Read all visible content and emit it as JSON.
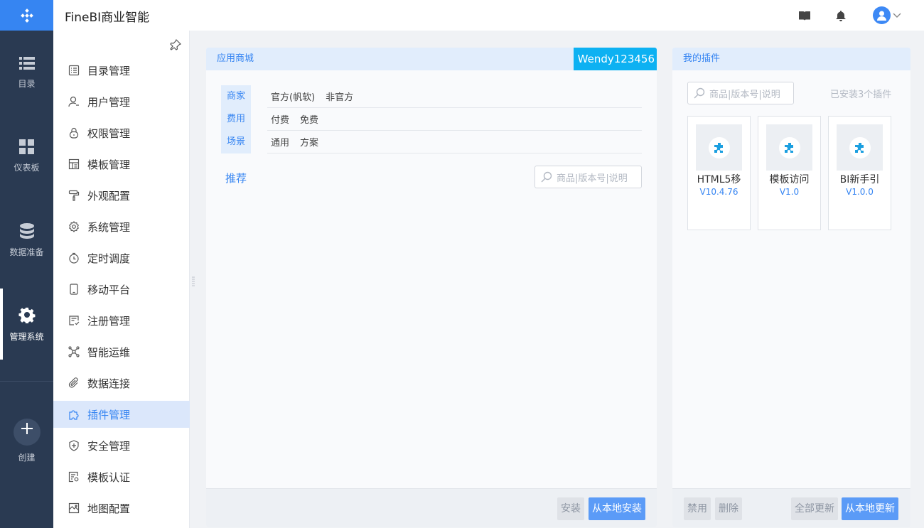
{
  "app": {
    "title": "FineBI商业智能"
  },
  "rail": {
    "items": [
      {
        "label": "目录",
        "icon": "list-icon"
      },
      {
        "label": "仪表板",
        "icon": "dashboard-icon"
      },
      {
        "label": "数据准备",
        "icon": "database-icon"
      },
      {
        "label": "管理系统",
        "icon": "gear-icon",
        "active": true
      },
      {
        "label": "创建",
        "icon": "plus-icon"
      }
    ]
  },
  "subnav": {
    "items": [
      {
        "label": "目录管理"
      },
      {
        "label": "用户管理"
      },
      {
        "label": "权限管理"
      },
      {
        "label": "模板管理"
      },
      {
        "label": "外观配置"
      },
      {
        "label": "系统管理"
      },
      {
        "label": "定时调度"
      },
      {
        "label": "移动平台"
      },
      {
        "label": "注册管理"
      },
      {
        "label": "智能运维"
      },
      {
        "label": "数据连接"
      },
      {
        "label": "插件管理",
        "active": true
      },
      {
        "label": "安全管理"
      },
      {
        "label": "模板认证"
      },
      {
        "label": "地图配置"
      }
    ]
  },
  "store": {
    "title": "应用商城",
    "user": "Wendy123456",
    "filters": [
      {
        "label": "商家",
        "options": [
          "官方(帆软)",
          "非官方"
        ]
      },
      {
        "label": "费用",
        "options": [
          "付费",
          "免费"
        ]
      },
      {
        "label": "场景",
        "options": [
          "通用",
          "方案"
        ]
      }
    ],
    "tab": "推荐",
    "search_placeholder": "商品|版本号|说明",
    "buttons": {
      "install": "安装",
      "install_local": "从本地安装"
    }
  },
  "my_plugins": {
    "title": "我的插件",
    "search_placeholder": "商品|版本号|说明",
    "installed_count": "已安装3个插件",
    "plugins": [
      {
        "name": "HTML5移",
        "version": "V10.4.76"
      },
      {
        "name": "模板访问",
        "version": "V1.0"
      },
      {
        "name": "BI新手引",
        "version": "V1.0.0"
      }
    ],
    "buttons": {
      "disable": "禁用",
      "delete": "删除",
      "update_all": "全部更新",
      "update_local": "从本地更新"
    }
  },
  "colors": {
    "primary": "#3685f2",
    "rail_bg": "#2a3a52",
    "badge": "#0db1f2"
  }
}
